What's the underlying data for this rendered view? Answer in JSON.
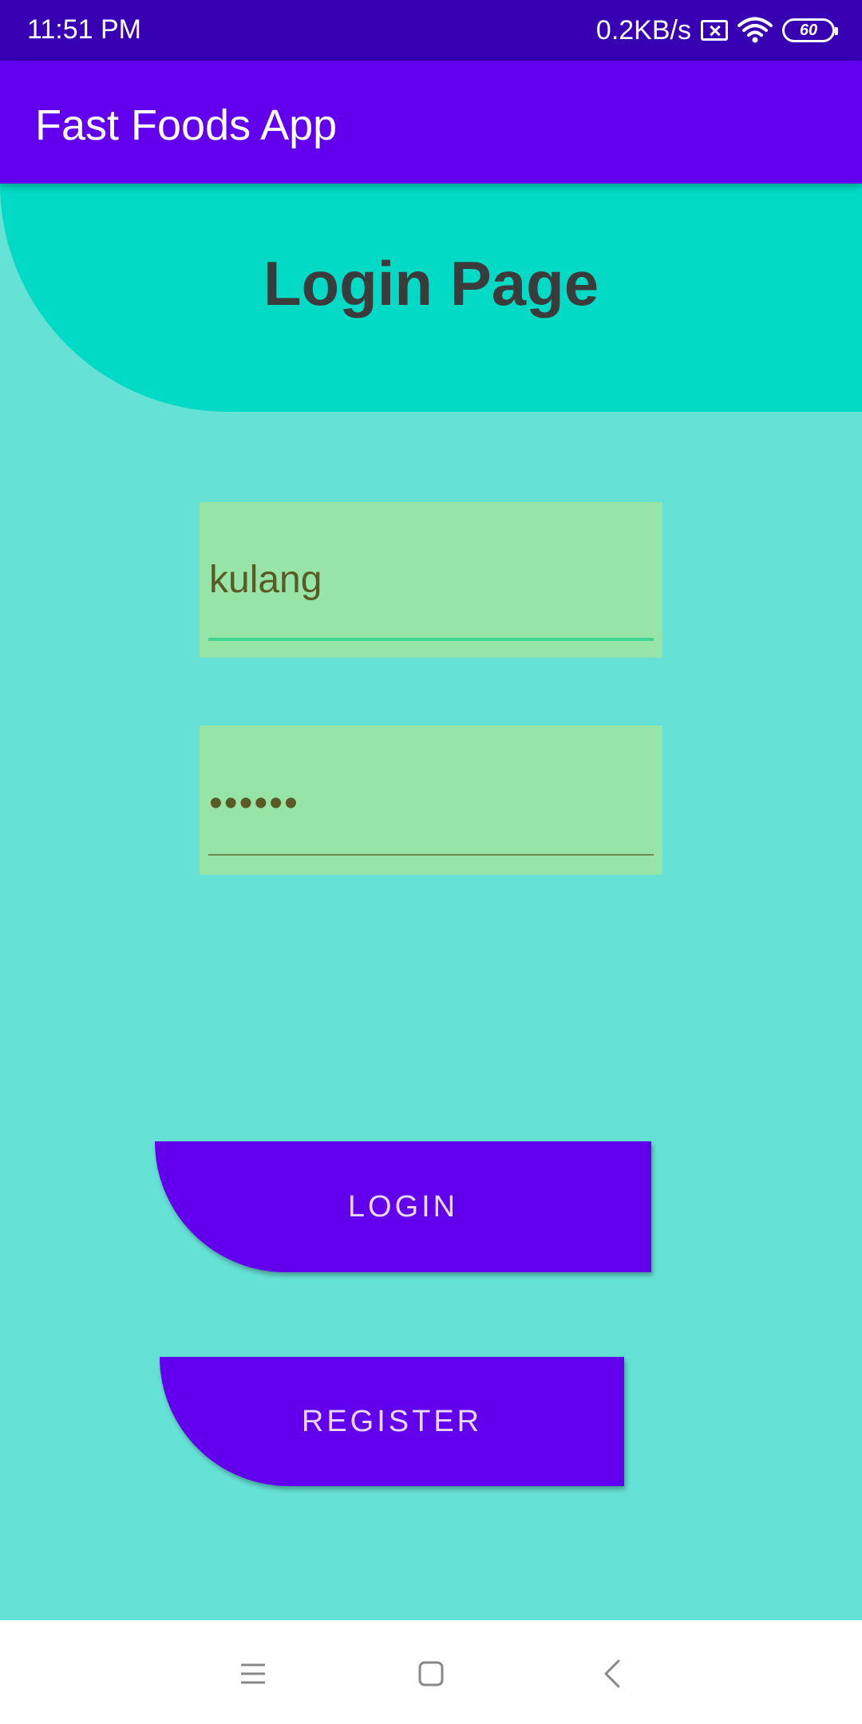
{
  "status_bar": {
    "time": "11:51 PM",
    "net_speed": "0.2KB/s",
    "battery_level": "60",
    "icons": [
      "sim-x-icon",
      "wifi-icon",
      "battery-icon"
    ]
  },
  "app_bar": {
    "title": "Fast Foods App"
  },
  "header": {
    "title": "Login Page"
  },
  "form": {
    "username_value": "kulang",
    "password_value": "••••••"
  },
  "buttons": {
    "login_label": "LOGIN",
    "register_label": "REGISTER"
  },
  "nav_bar": {
    "icons": [
      "menu-icon",
      "home-icon",
      "back-icon"
    ]
  },
  "colors": {
    "status_bar": "#3700b3",
    "primary": "#6200ee",
    "header_teal": "#03dac5",
    "background": "#66e1d5",
    "field_bg": "#97e5a6"
  }
}
